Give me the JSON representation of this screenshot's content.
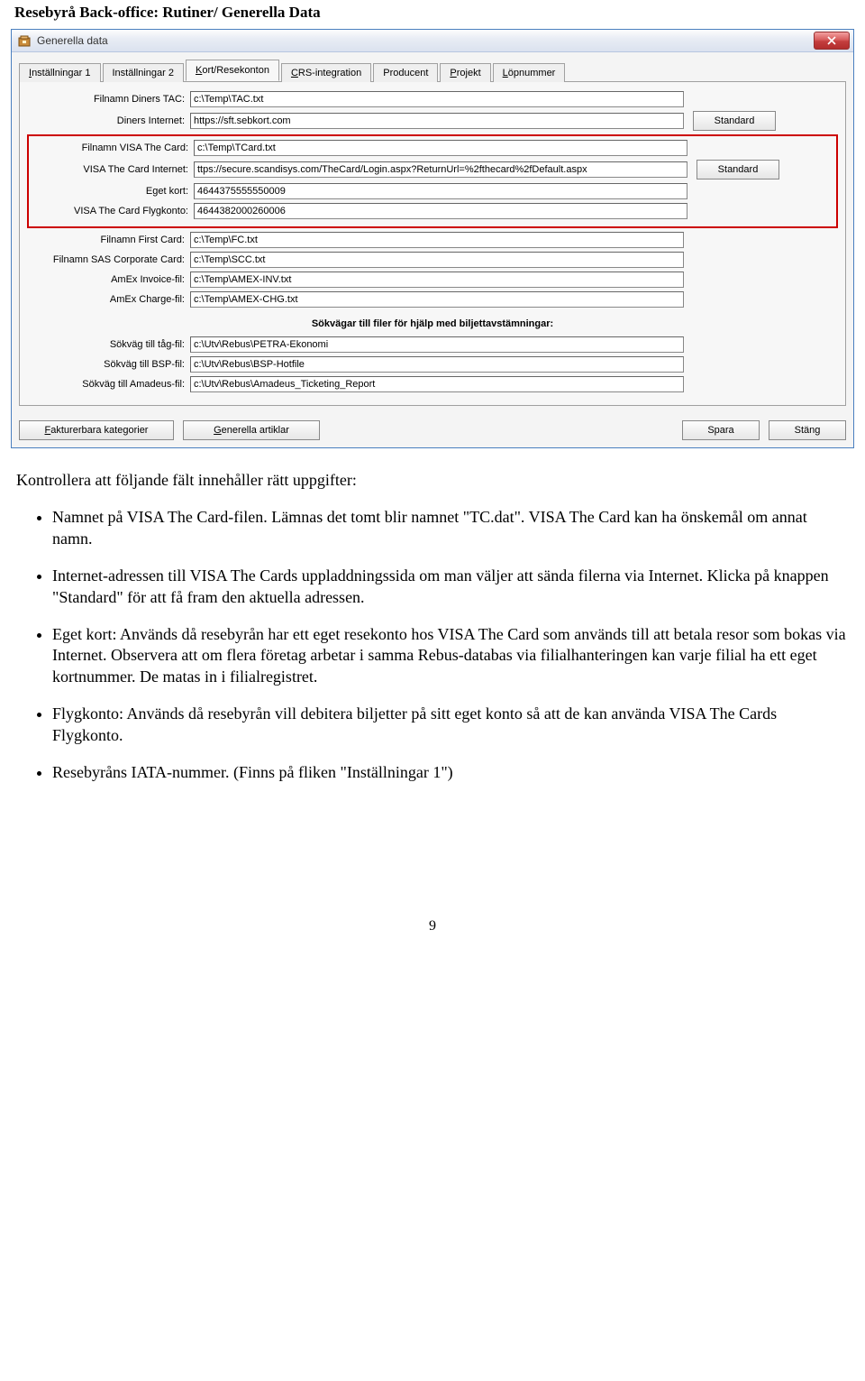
{
  "page_header": "Resebyrå Back-office: Rutiner/ Generella Data",
  "window": {
    "title": "Generella data",
    "tabs": {
      "t1": "nställningar 1",
      "t2": "Inställningar 2",
      "t3": "ort/Resekonton",
      "t4": "RS-integration",
      "t5": "Producent",
      "t6": "rojekt",
      "t7": "öpnummer"
    },
    "labels": {
      "l1": "Filnamn Diners TAC:",
      "l2": "Diners Internet:",
      "l3": "Filnamn VISA The Card:",
      "l4": "VISA The Card Internet:",
      "l5": "Eget kort:",
      "l6": "VISA The Card Flygkonto:",
      "l7": "Filnamn First Card:",
      "l8": "Filnamn SAS Corporate Card:",
      "l9": "AmEx Invoice-fil:",
      "l10": "AmEx Charge-fil:",
      "sec": "Sökvägar till filer för hjälp med biljettavstämningar:",
      "l11": "Sökväg till tåg-fil:",
      "l12": "Sökväg till BSP-fil:",
      "l13": "Sökväg till Amadeus-fil:"
    },
    "values": {
      "v1": "c:\\Temp\\TAC.txt",
      "v2": "https://sft.sebkort.com",
      "v3": "c:\\Temp\\TCard.txt",
      "v4": "ttps://secure.scandisys.com/TheCard/Login.aspx?ReturnUrl=%2fthecard%2fDefault.aspx",
      "v5": "4644375555550009",
      "v6": "4644382000260006",
      "v7": "c:\\Temp\\FC.txt",
      "v8": "c:\\Temp\\SCC.txt",
      "v9": "c:\\Temp\\AMEX-INV.txt",
      "v10": "c:\\Temp\\AMEX-CHG.txt",
      "v11": "c:\\Utv\\Rebus\\PETRA-Ekonomi",
      "v12": "c:\\Utv\\Rebus\\BSP-Hotfile",
      "v13": "c:\\Utv\\Rebus\\Amadeus_Ticketing_Report"
    },
    "buttons": {
      "standard": "Standard",
      "fakturerbara": "akturerbara kategorier",
      "generella": "enerella artiklar",
      "spara": "Spara",
      "stang": "Stäng"
    }
  },
  "body": {
    "intro": "Kontrollera att följande fält innehåller rätt uppgifter:",
    "b1": "Namnet på VISA The Card-filen. Lämnas det tomt blir namnet \"TC.dat\". VISA The Card kan ha önskemål om annat namn.",
    "b2": "Internet-adressen till VISA The Cards uppladdningssida om man väljer att sända filerna via Internet. Klicka på knappen \"Standard\" för att få fram den aktuella adressen.",
    "b3": "Eget kort: Används då resebyrån har ett eget resekonto hos VISA The Card som används till att betala resor som bokas via Internet. Observera att om flera företag arbetar i samma Rebus-databas via filialhanteringen kan varje filial ha ett eget kortnummer. De matas in i filialregistret.",
    "b4": "Flygkonto: Används då resebyrån vill debitera biljetter på sitt eget konto så att de kan använda VISA The Cards Flygkonto.",
    "b5": "Resebyråns IATA-nummer. (Finns på fliken \"Inställningar 1\")"
  },
  "page_number": "9"
}
